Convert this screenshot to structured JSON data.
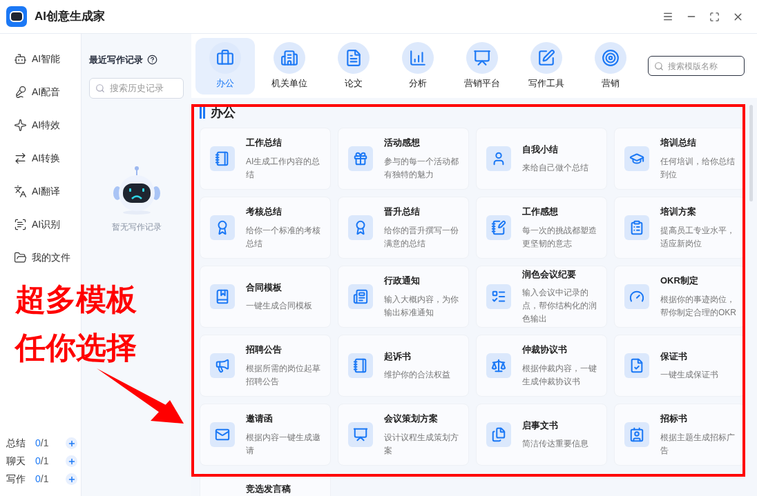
{
  "app": {
    "title": "AI创意生成家"
  },
  "nav": [
    {
      "label": "AI智能",
      "selected": false
    },
    {
      "label": "AI配音",
      "selected": false
    },
    {
      "label": "AI特效",
      "selected": false
    },
    {
      "label": "AI转换",
      "selected": false
    },
    {
      "label": "AI翻译",
      "selected": false
    },
    {
      "label": "AI识别",
      "selected": false
    },
    {
      "label": "我的文件",
      "selected": false
    }
  ],
  "quota": [
    {
      "label": "总结",
      "used": "0",
      "limit": "/1"
    },
    {
      "label": "聊天",
      "used": "0",
      "limit": "/1"
    },
    {
      "label": "写作",
      "used": "0",
      "limit": "/1"
    }
  ],
  "history": {
    "title": "最近写作记录",
    "search_placeholder": "搜索历史记录",
    "empty_text": "暂无写作记录"
  },
  "categories": [
    {
      "label": "办公",
      "selected": true
    },
    {
      "label": "机关单位",
      "selected": false
    },
    {
      "label": "论文",
      "selected": false
    },
    {
      "label": "分析",
      "selected": false
    },
    {
      "label": "营销平台",
      "selected": false
    },
    {
      "label": "写作工具",
      "selected": false
    },
    {
      "label": "营销",
      "selected": false
    }
  ],
  "template_search": {
    "placeholder": "搜索模版名称"
  },
  "section_title": "办公",
  "templates": [
    {
      "title": "工作总结",
      "description": "AI生成工作内容的总结"
    },
    {
      "title": "活动感想",
      "description": "参与的每一个活动都有独特的魅力"
    },
    {
      "title": "自我小结",
      "description": "来给自己做个总结"
    },
    {
      "title": "培训总结",
      "description": "任何培训，给你总结到位"
    },
    {
      "title": "考核总结",
      "description": "给你一个标准的考核总结"
    },
    {
      "title": "晋升总结",
      "description": "给你的晋升撰写一份满意的总结"
    },
    {
      "title": "工作感想",
      "description": "每一次的挑战都塑造更坚韧的意志"
    },
    {
      "title": "培训方案",
      "description": "提高员工专业水平，适应新岗位"
    },
    {
      "title": "合同模板",
      "description": "一键生成合同模板"
    },
    {
      "title": "行政通知",
      "description": "输入大概内容，为你输出标准通知"
    },
    {
      "title": "润色会议纪要",
      "description": "输入会议中记录的点，帮你结构化的润色输出"
    },
    {
      "title": "OKR制定",
      "description": "根据你的事迹岗位，帮你制定合理的OKR"
    },
    {
      "title": "招聘公告",
      "description": "根据所需的岗位起草招聘公告"
    },
    {
      "title": "起诉书",
      "description": "维护你的合法权益"
    },
    {
      "title": "仲裁协议书",
      "description": "根据仲裁内容，一键生成仲裁协议书"
    },
    {
      "title": "保证书",
      "description": "一键生成保证书"
    },
    {
      "title": "邀请函",
      "description": "根据内容一键生成邀请"
    },
    {
      "title": "会议策划方案",
      "description": "设计议程生成策划方案"
    },
    {
      "title": "启事文书",
      "description": "简洁传达重要信息"
    },
    {
      "title": "招标书",
      "description": "根据主题生成招标广告"
    }
  ],
  "partial_template": {
    "title": "竞选发言稿"
  },
  "annotation": {
    "lines": [
      "超多模板",
      "任你选择"
    ]
  }
}
